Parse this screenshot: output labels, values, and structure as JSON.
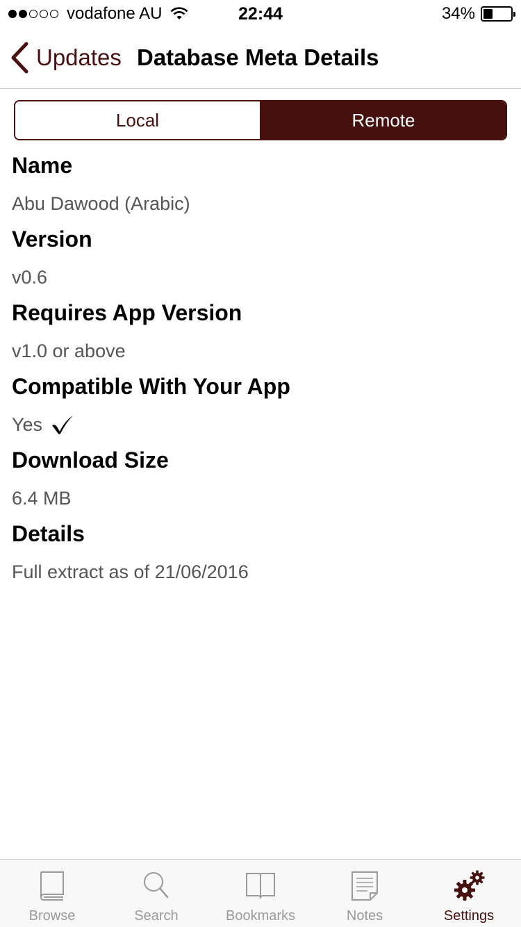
{
  "status_bar": {
    "carrier": "vodafone AU",
    "time": "22:44",
    "battery_percent_text": "34%",
    "battery_level": 0.34
  },
  "nav": {
    "back_label": "Updates",
    "title": "Database Meta Details"
  },
  "segments": {
    "local": "Local",
    "remote": "Remote",
    "selected": "remote"
  },
  "fields": [
    {
      "label": "Name",
      "value": "Abu Dawood (Arabic)"
    },
    {
      "label": "Version",
      "value": "v0.6"
    },
    {
      "label": "Requires App Version",
      "value": "v1.0 or above"
    },
    {
      "label": "Compatible With Your App",
      "value": "Yes",
      "icon": "checkmark-icon"
    },
    {
      "label": "Download Size",
      "value": "6.4 MB"
    },
    {
      "label": "Details",
      "value": "Full extract as of 21/06/2016"
    }
  ],
  "tabs": [
    {
      "label": "Browse",
      "icon": "book-icon"
    },
    {
      "label": "Search",
      "icon": "search-icon"
    },
    {
      "label": "Bookmarks",
      "icon": "open-book-icon"
    },
    {
      "label": "Notes",
      "icon": "notes-icon"
    },
    {
      "label": "Settings",
      "icon": "gears-icon",
      "active": true
    }
  ],
  "colors": {
    "accent": "#4a1010",
    "selected_segment": "#45100d",
    "inactive_tab": "#9a9a9a"
  }
}
